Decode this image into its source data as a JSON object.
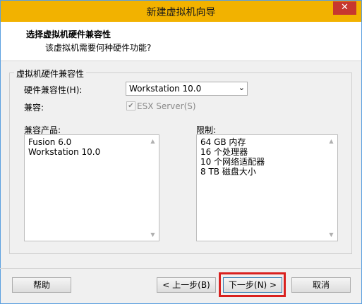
{
  "window": {
    "title": "新建虚拟机向导",
    "close_glyph": "✕"
  },
  "header": {
    "title": "选择虚拟机硬件兼容性",
    "subtitle": "该虚拟机需要何种硬件功能?"
  },
  "group": {
    "label": "虚拟机硬件兼容性",
    "compat_label": "硬件兼容性(H):",
    "compat_value": "Workstation 10.0",
    "compatible_label": "兼容:",
    "esx_checkbox_label": "ESX Server(S)",
    "esx_checked": true,
    "products_label": "兼容产品:",
    "products": [
      "Fusion 6.0",
      "Workstation 10.0"
    ],
    "limits_label": "限制:",
    "limits": [
      "64 GB 内存",
      "16 个处理器",
      "10 个网络适配器",
      "8 TB 磁盘大小"
    ]
  },
  "buttons": {
    "help": "帮助",
    "back": "< 上一步(B)",
    "next": "下一步(N) >",
    "cancel": "取消"
  }
}
